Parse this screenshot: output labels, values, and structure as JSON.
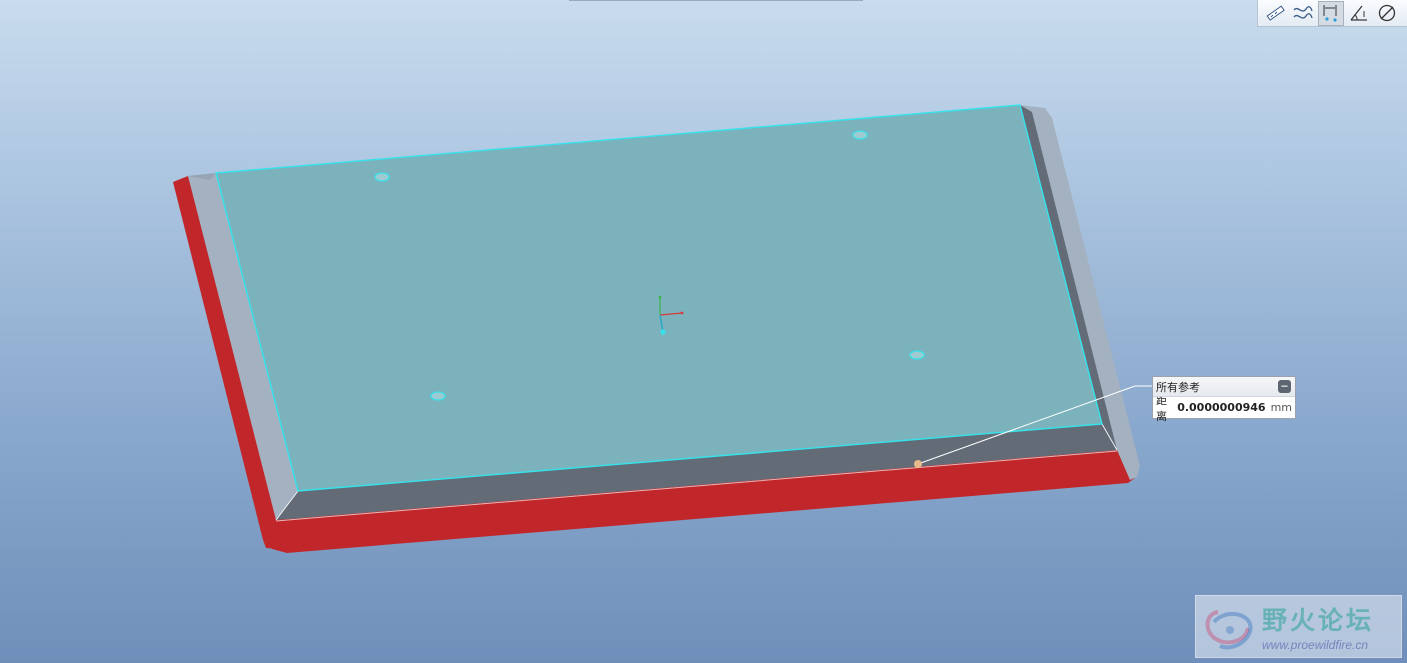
{
  "toolbar": {
    "tools": [
      {
        "icon": "measure-length-icon",
        "active": false
      },
      {
        "icon": "measure-curve-icon",
        "active": false
      },
      {
        "icon": "measure-distance-icon",
        "active": true
      },
      {
        "icon": "measure-angle-icon",
        "active": false
      },
      {
        "icon": "measure-diameter-icon",
        "active": false
      }
    ]
  },
  "callout": {
    "header": "所有参考",
    "label": "距离",
    "value": "0.0000000946",
    "unit": "mm",
    "collapse_symbol": "−"
  },
  "watermark": {
    "title": "野火论坛",
    "url": "www.proewildfire.cn"
  },
  "colors": {
    "model_top": "#7bb2bc",
    "selected_edge": "#35e3ec",
    "side_face_red": "#c1272a",
    "chamfer_light": "#a3b1c0",
    "chamfer_dark": "#626b76"
  }
}
